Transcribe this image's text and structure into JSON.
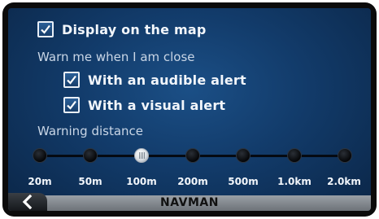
{
  "settings": {
    "display_on_map": {
      "label": "Display on the map",
      "checked": true
    },
    "warn_heading": "Warn me when I am close",
    "audible_alert": {
      "label": "With an audible alert",
      "checked": true
    },
    "visual_alert": {
      "label": "With a visual alert",
      "checked": true
    },
    "warning_distance_heading": "Warning distance"
  },
  "warning_distance": {
    "options": [
      "20m",
      "50m",
      "100m",
      "200m",
      "500m",
      "1.0km",
      "2.0km"
    ],
    "selected": "100m"
  },
  "bottom_bar": {
    "title": "NAVMAN",
    "back_icon": "chevron-left-icon"
  },
  "colors": {
    "screen_background": "#123b6a",
    "text": "#f2f6fb",
    "bottom_bar": "#8a9096"
  }
}
